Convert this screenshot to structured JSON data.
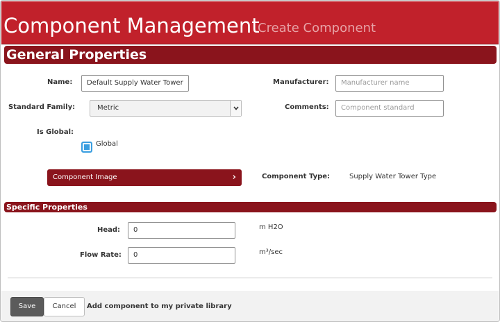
{
  "header": {
    "title": "Component Management",
    "subtitle": "Create Component"
  },
  "sections": {
    "general": "General Properties",
    "specific": "Specific Properties"
  },
  "general": {
    "name_label": "Name:",
    "name_value": "Default Supply Water Tower",
    "manufacturer_label": "Manufacturer:",
    "manufacturer_placeholder": "Manufacturer name",
    "standard_family_label": "Standard Family:",
    "standard_family_value": "Metric",
    "comments_label": "Comments:",
    "comments_placeholder": "Component standard",
    "is_global_label": "Is Global:",
    "global_checkbox_label": "Global",
    "global_checked": true,
    "component_image_label": "Component Image",
    "component_type_label": "Component Type:",
    "component_type_value": "Supply Water Tower Type"
  },
  "specific": {
    "head_label": "Head:",
    "head_value": "0",
    "head_unit": "m H2O",
    "flow_rate_label": "Flow Rate:",
    "flow_rate_value": "0",
    "flow_rate_unit": "m³/sec"
  },
  "footer": {
    "save_label": "Save",
    "cancel_label": "Cancel",
    "private_library_label": "Add component to my private library"
  },
  "colors": {
    "header_red": "#c1212b",
    "section_dark_red": "#8a141c",
    "checkbox_blue": "#3a9ee0"
  },
  "icons": {
    "select_arrow": "chevron-down-icon",
    "image_button_arrow": "chevron-right-icon"
  }
}
